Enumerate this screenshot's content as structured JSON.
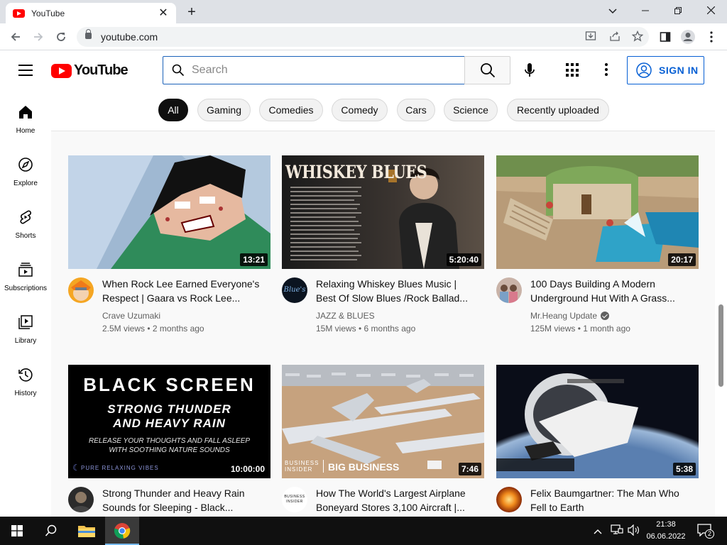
{
  "browser": {
    "tab_title": "YouTube",
    "close_glyph": "✕",
    "new_tab_glyph": "+",
    "url": "youtube.com",
    "window_controls": [
      "⌄",
      "—",
      "❐",
      "✕"
    ]
  },
  "header": {
    "logo_text": "YouTube",
    "search_placeholder": "Search",
    "sign_in_label": "SIGN IN"
  },
  "guide": {
    "items": [
      {
        "label": "Home",
        "icon": "home-icon"
      },
      {
        "label": "Explore",
        "icon": "explore-icon"
      },
      {
        "label": "Shorts",
        "icon": "shorts-icon"
      },
      {
        "label": "Subscriptions",
        "icon": "subscriptions-icon"
      },
      {
        "label": "Library",
        "icon": "library-icon"
      },
      {
        "label": "History",
        "icon": "history-icon"
      }
    ]
  },
  "chips": [
    "All",
    "Gaming",
    "Comedies",
    "Comedy",
    "Cars",
    "Science",
    "Recently uploaded"
  ],
  "videos": [
    {
      "title": "When Rock Lee Earned Everyone's Respect | Gaara vs Rock Lee...",
      "channel": "Crave Uzumaki",
      "meta": "2.5M views • 2 months ago",
      "duration": "13:21",
      "verified": false
    },
    {
      "title": "Relaxing Whiskey Blues Music | Best Of Slow Blues /Rock Ballad...",
      "channel": "JAZZ & BLUES",
      "meta": "15M views • 6 months ago",
      "duration": "5:20:40",
      "verified": false
    },
    {
      "title": "100 Days Building A Modern Underground Hut With A Grass...",
      "channel": "Mr.Heang Update",
      "meta": "125M views • 1 month ago",
      "duration": "20:17",
      "verified": true
    },
    {
      "title": "Strong Thunder and Heavy Rain Sounds for Sleeping - Black...",
      "channel": "",
      "meta": "",
      "duration": "10:00:00",
      "verified": false
    },
    {
      "title": "How The World's Largest Airplane Boneyard Stores 3,100 Aircraft |...",
      "channel": "",
      "meta": "",
      "duration": "7:46",
      "verified": false
    },
    {
      "title": "Felix Baumgartner: The Man Who Fell to Earth",
      "channel": "",
      "meta": "",
      "duration": "5:38",
      "verified": false
    }
  ],
  "thumb_text": {
    "whiskey": "WHISKEY BLUES",
    "black_screen": "BLACK SCREEN",
    "thunder_line1": "STRONG THUNDER",
    "thunder_line2": "AND HEAVY RAIN",
    "thunder_sub1": "RELEASE YOUR THOUGHTS AND FALL ASLEEP",
    "thunder_sub2": "WITH SOOTHING NATURE SOUNDS",
    "thunder_brand": "PURE RELAXING VIBES",
    "bi_brand_1": "BUSINESS",
    "bi_brand_2": "INSIDER",
    "bi_show": "BIG BUSINESS",
    "jazz_avatar": "Blue's",
    "bi_avatar_1": "BUSINESS",
    "bi_avatar_2": "INSIDER"
  },
  "taskbar": {
    "time": "21:38",
    "date": "06.06.2022",
    "notification_count": "2"
  },
  "colors": {
    "youtube_red": "#ff0000",
    "link_blue": "#065fd4",
    "chip_active": "#0f0f0f"
  }
}
